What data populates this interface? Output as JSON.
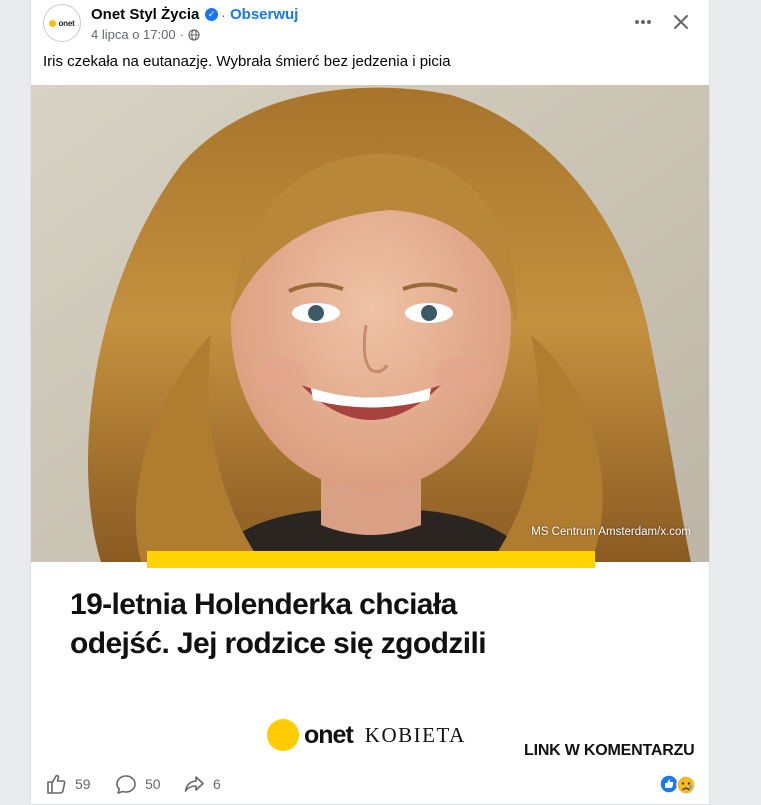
{
  "post": {
    "page_name": "Onet Styl Życia",
    "avatar_text": "onet",
    "follow_label": "Obserwuj",
    "timestamp": "4 lipca o 17:00",
    "meta_sep": "·",
    "text": "Iris czekała na eutanazję. Wybrała śmierć bez jedzenia i picia"
  },
  "link_card": {
    "photo_credit": "MS Centrum Amsterdam/x.com",
    "headline_line1": "19-letnia Holenderka chciała",
    "headline_line2": "odejść. Jej rodzice się zgodzili",
    "brand_name": "onet",
    "brand_section": "KOBIETA",
    "cta": "LINK W KOMENTARZU"
  },
  "actions": {
    "like_count": "59",
    "comment_count": "50",
    "share_count": "6"
  },
  "icons": {
    "verified": "verified-badge-icon",
    "globe": "globe-icon",
    "more": "more-options-icon",
    "close": "close-icon",
    "like": "thumbs-up-icon",
    "comment": "comment-bubble-icon",
    "share": "share-arrow-icon",
    "reactions": [
      "like-reaction-icon",
      "sad-reaction-icon"
    ]
  },
  "colors": {
    "accent_blue": "#1877f2",
    "brand_yellow": "#ffd400",
    "muted_text": "#65676b"
  }
}
